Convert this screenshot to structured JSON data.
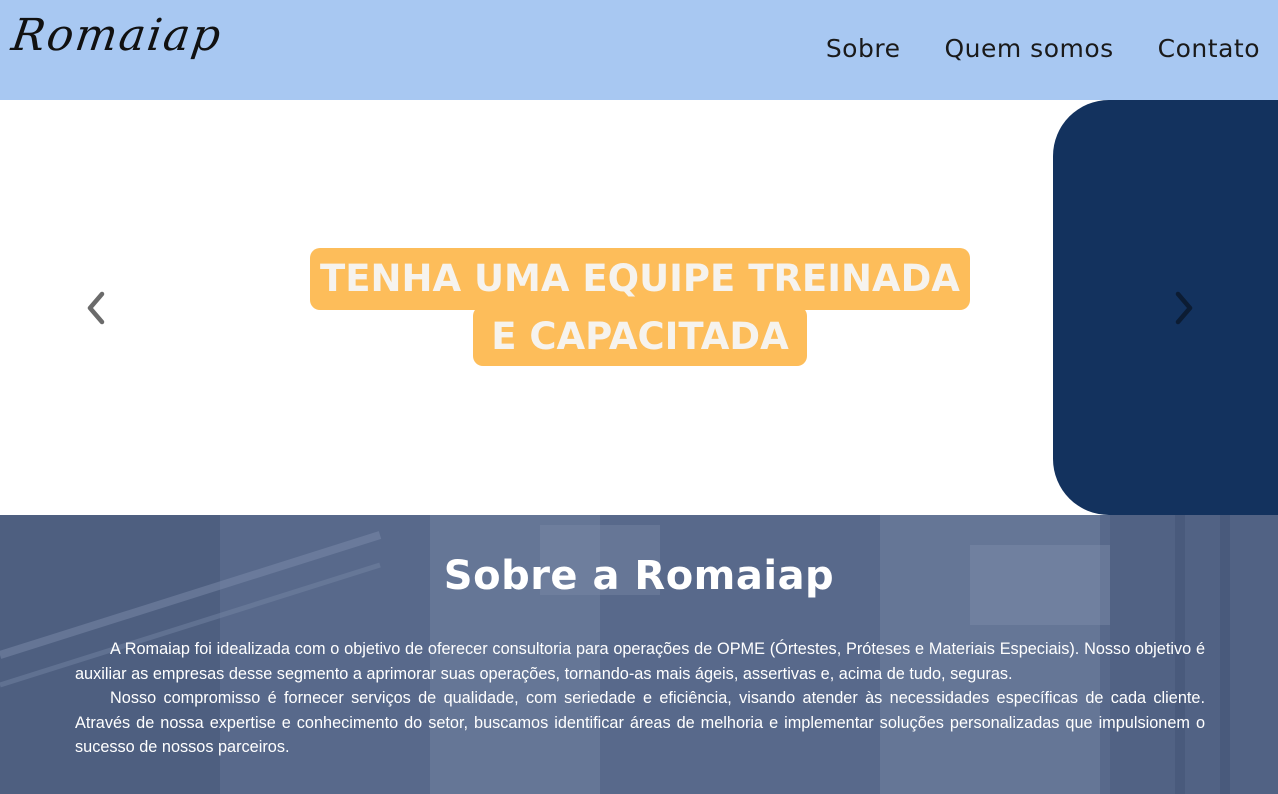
{
  "header": {
    "logo": "Romaiap",
    "nav": [
      {
        "label": "Sobre"
      },
      {
        "label": "Quem somos"
      },
      {
        "label": "Contato"
      }
    ]
  },
  "carousel": {
    "headline_line1": "TENHA UMA EQUIPE TREINADA",
    "headline_line2": "E CAPACITADA",
    "prev_icon": "chevron-left-icon",
    "next_icon": "chevron-right-icon",
    "colors": {
      "headline_bg": "#fdbd5a",
      "next_slide_bg": "#13325e"
    }
  },
  "about": {
    "title": "Sobre a Romaiap",
    "paragraphs": [
      "A Romaiap foi idealizada com o objetivo de oferecer consultoria para operações de OPME (Órtestes, Próteses e Materiais Especiais). Nosso objetivo é auxiliar as empresas desse segmento a aprimorar suas operações, tornando-as mais ágeis, assertivas e, acima de tudo, seguras.",
      "Nosso compromisso é fornecer serviços de qualidade, com seriedade e eficiência, visando atender às necessidades específicas de cada cliente. Através de nossa expertise e conhecimento do setor, buscamos identificar áreas de melhoria e implementar soluções personalizadas que impulsionem o sucesso de nossos parceiros."
    ]
  },
  "colors": {
    "header_bg": "#a8c8f2",
    "about_overlay": "#56698c"
  }
}
